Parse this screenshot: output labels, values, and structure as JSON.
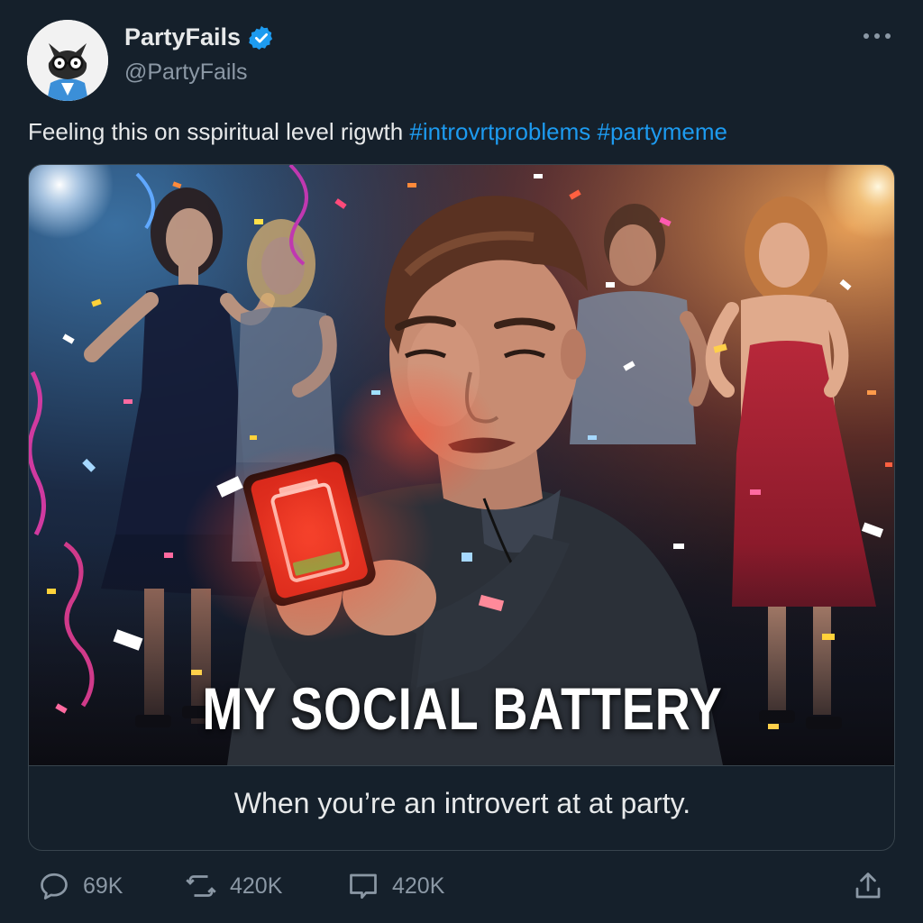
{
  "account": {
    "display_name": "PartyFails",
    "handle": "@PartyFails",
    "verified": true,
    "avatar_icon": "cat-with-glasses-icon"
  },
  "post": {
    "text_plain": "Feeling this on sspiritual level rigwth ",
    "hashtags": [
      "#introvrtproblems",
      "#partymeme"
    ]
  },
  "media": {
    "meme_text": "MY SOCIAL BATTERY",
    "caption": "When you’re an introvert at at party."
  },
  "actions": {
    "replies": "69K",
    "retweets": "420K",
    "comments": "420K"
  },
  "colors": {
    "background": "#15202b",
    "accent": "#1d9bf0",
    "muted": "#8b98a5",
    "border": "#38444d"
  }
}
